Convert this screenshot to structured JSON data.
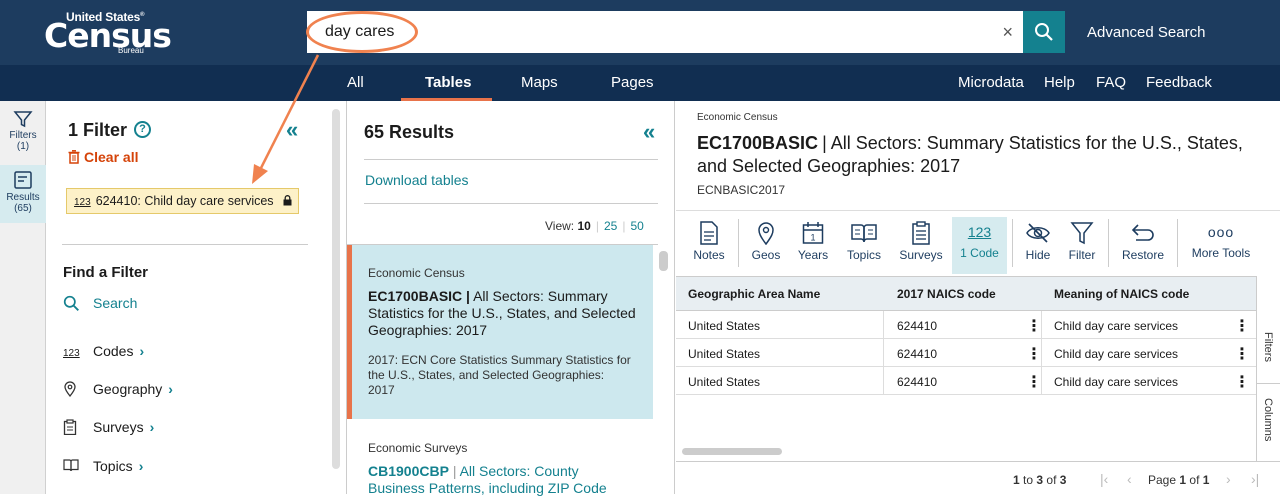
{
  "header": {
    "logo_top": "United States",
    "logo_reg": "®",
    "logo_main": "Census",
    "logo_bottom": "Bureau",
    "search_value": "day cares",
    "clear_symbol": "×",
    "advanced_search": "Advanced Search"
  },
  "nav": {
    "all": "All",
    "tables": "Tables",
    "maps": "Maps",
    "pages": "Pages",
    "microdata": "Microdata",
    "help": "Help",
    "faq": "FAQ",
    "feedback": "Feedback"
  },
  "rail": {
    "filters_label": "Filters",
    "filters_count": "(1)",
    "results_label": "Results",
    "results_count": "(65)"
  },
  "filter_panel": {
    "title": "1 Filter",
    "help": "?",
    "collapse": "«",
    "clear_all": "Clear all",
    "chip_code_icon": "123",
    "chip_label": "624410: Child day care services",
    "find_title": "Find a Filter",
    "search": "Search",
    "codes_icon": "123",
    "codes": "Codes",
    "geography": "Geography",
    "surveys": "Surveys",
    "topics": "Topics",
    "chevron": "›"
  },
  "results": {
    "title": "65 Results",
    "collapse": "«",
    "download": "Download tables",
    "view_label": "View:",
    "view_options": [
      "10",
      "25",
      "50"
    ],
    "cards": [
      {
        "category": "Economic Census",
        "id": "EC1700BASIC",
        "title": "All Sectors: Summary Statistics for the U.S., States, and Selected Geographies: 2017",
        "desc": "2017: ECN Core Statistics Summary Statistics for the U.S., States, and Selected Geographies: 2017"
      },
      {
        "category": "Economic Surveys",
        "id": "CB1900CBP",
        "title": "All Sectors: County Business Patterns, including ZIP Code"
      }
    ]
  },
  "detail": {
    "category": "Economic Census",
    "id": "EC1700BASIC",
    "title": "All Sectors: Summary Statistics for the U.S., States, and Selected Geographies: 2017",
    "sub": "ECNBASIC2017",
    "tools": {
      "notes": "Notes",
      "geos": "Geos",
      "years": "Years",
      "topics": "Topics",
      "surveys": "Surveys",
      "code_icon": "123",
      "code": "1 Code",
      "hide": "Hide",
      "filter": "Filter",
      "restore": "Restore",
      "more_icon": "ooo",
      "more": "More Tools"
    },
    "columns": [
      "Geographic Area Name",
      "2017 NAICS code",
      "Meaning of NAICS code"
    ],
    "rows": [
      [
        "United States",
        "624410",
        "Child day care services"
      ],
      [
        "United States",
        "624410",
        "Child day care services"
      ],
      [
        "United States",
        "624410",
        "Child day care services"
      ]
    ],
    "kebab": "⋮",
    "side_tabs": [
      "Filters",
      "Columns"
    ],
    "pager": {
      "from": "1",
      "to_word": "to",
      "to": "3",
      "of_word": "of",
      "total": "3",
      "page_word": "Page",
      "page": "1",
      "page_of": "of",
      "pages": "1",
      "first": "|‹",
      "prev": "‹",
      "next": "›",
      "last": "›|"
    }
  },
  "colors": {
    "header_bg": "#1d3c5f",
    "nav_bg": "#112e51",
    "accent_teal": "#14818f",
    "annotation_orange": "#f0824f",
    "clear_all_red": "#d54309",
    "chip_bg": "#fdf1c8",
    "selected_card_bg": "#cde8ee"
  }
}
